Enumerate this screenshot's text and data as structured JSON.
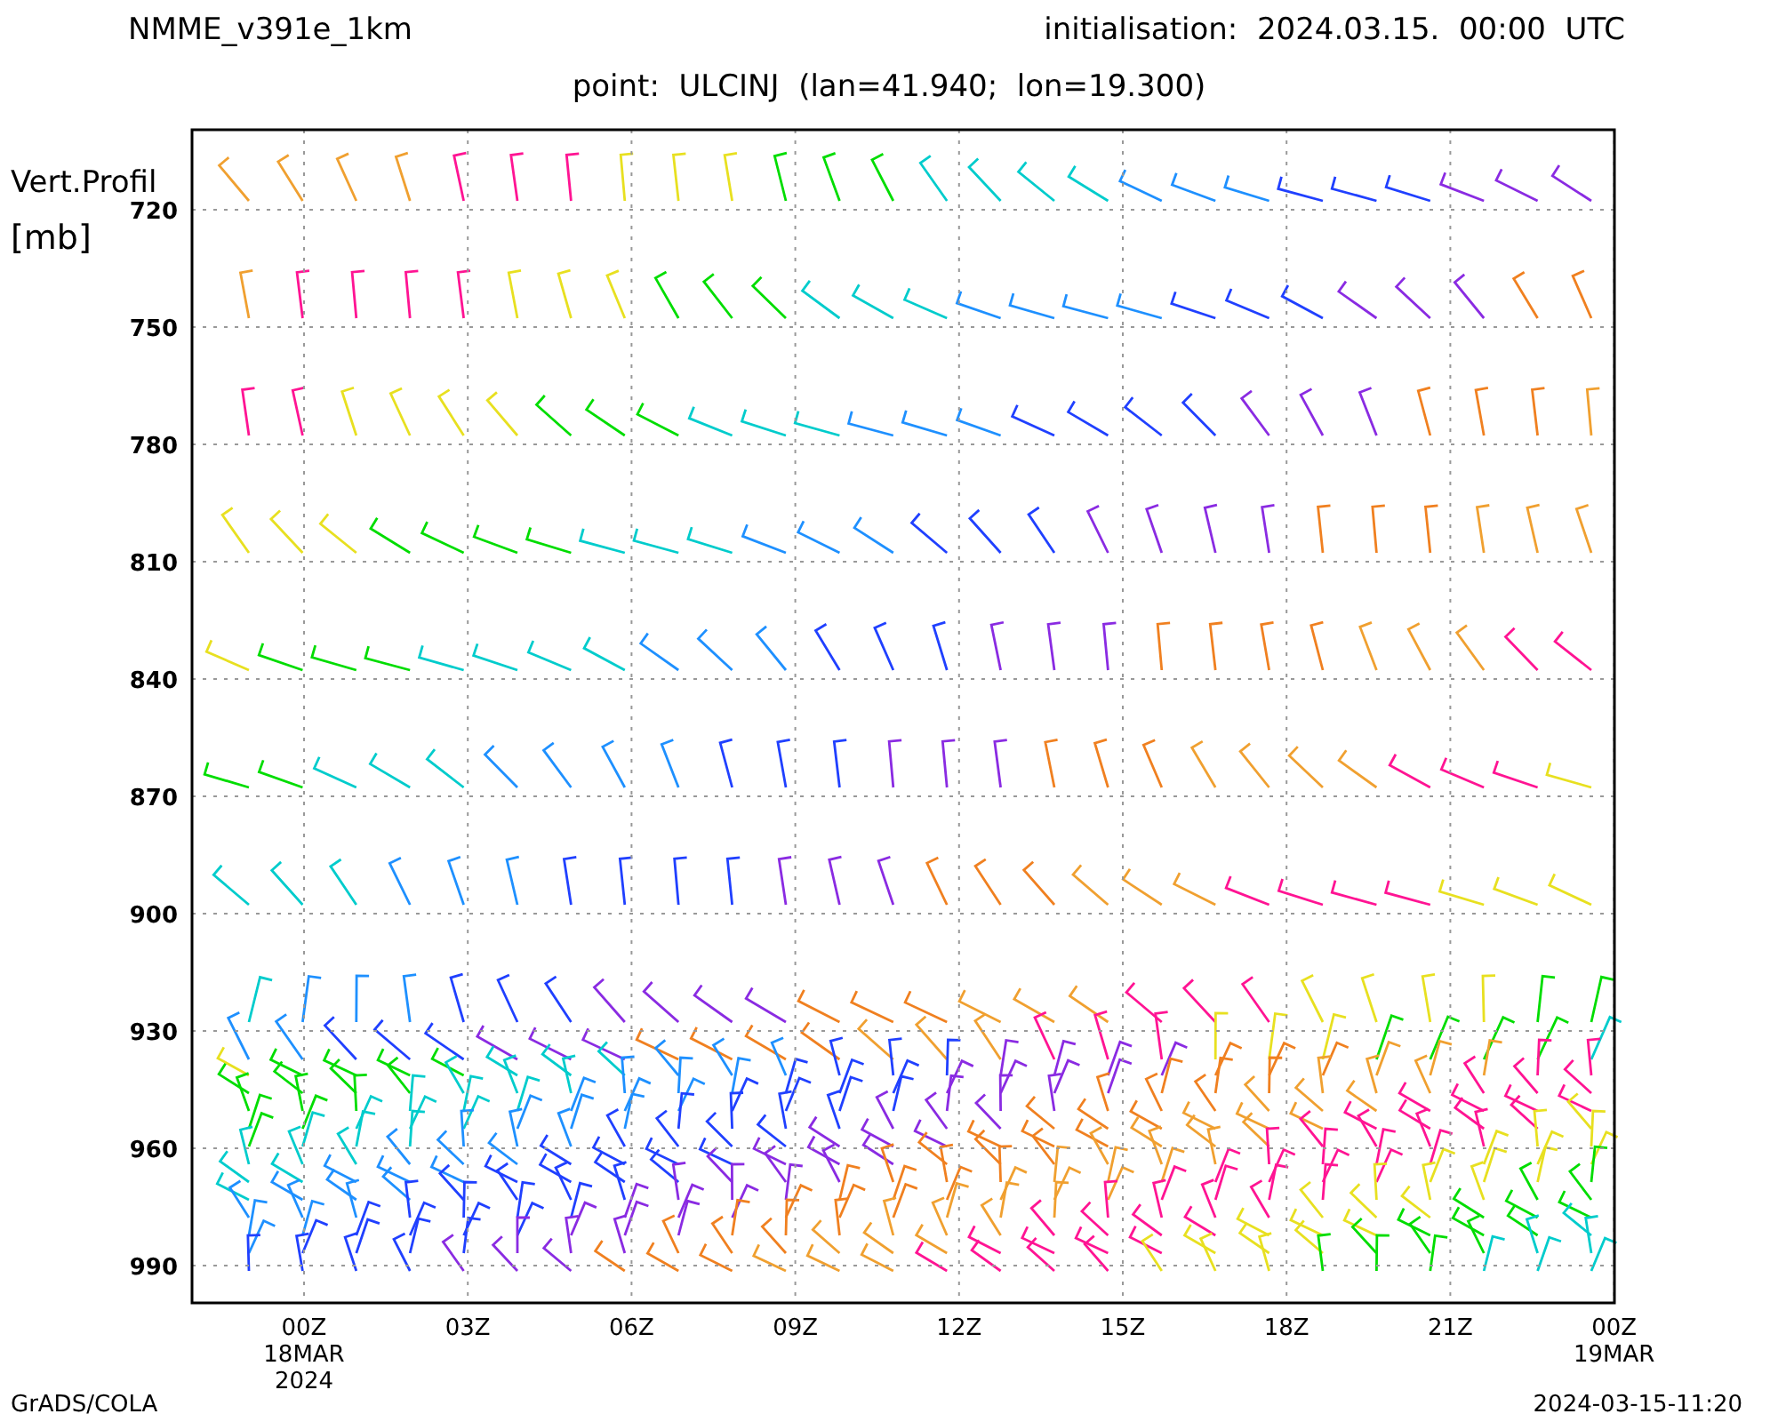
{
  "header": {
    "model": "NMME_v391e_1km",
    "initialisation": "initialisation:  2024.03.15.  00:00  UTC",
    "point": "point:  ULCINJ  (lan=41.940;  lon=19.300)"
  },
  "y_axis": {
    "title": "Vert.Profil",
    "unit": "[mb]",
    "ticks": [
      "720",
      "750",
      "780",
      "810",
      "840",
      "870",
      "900",
      "930",
      "960",
      "990"
    ]
  },
  "x_axis": {
    "ticks": [
      {
        "label": "00Z",
        "lines": [
          "18MAR",
          "2024"
        ]
      },
      {
        "label": "03Z"
      },
      {
        "label": "06Z"
      },
      {
        "label": "09Z"
      },
      {
        "label": "12Z"
      },
      {
        "label": "15Z"
      },
      {
        "label": "18Z"
      },
      {
        "label": "21Z"
      },
      {
        "label": "00Z",
        "lines": [
          "19MAR"
        ]
      }
    ]
  },
  "footer": {
    "left": "GrADS/COLA",
    "right": "2024-03-15-11:20"
  }
}
